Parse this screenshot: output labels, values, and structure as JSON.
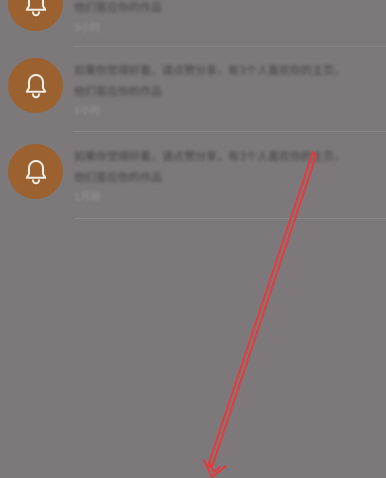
{
  "notifications": [
    {
      "icon": "bell-icon",
      "line1": "",
      "line2": "他们答应你的作品",
      "time": "3小时"
    },
    {
      "icon": "bell-icon",
      "line1": "如果你觉得好看，请点赞分享，有3个人喜欢你的主页，",
      "line2": "他们答应你的作品",
      "time": "1小时"
    },
    {
      "icon": "bell-icon",
      "line1": "如果你觉得好看，请点赞分享，有3个人喜欢你的主页，",
      "line2": "他们答应你的作品",
      "time": "1月前"
    }
  ],
  "colors": {
    "background": "#7d797a",
    "avatar": "#9b6230",
    "arrow": "#e5393c"
  }
}
